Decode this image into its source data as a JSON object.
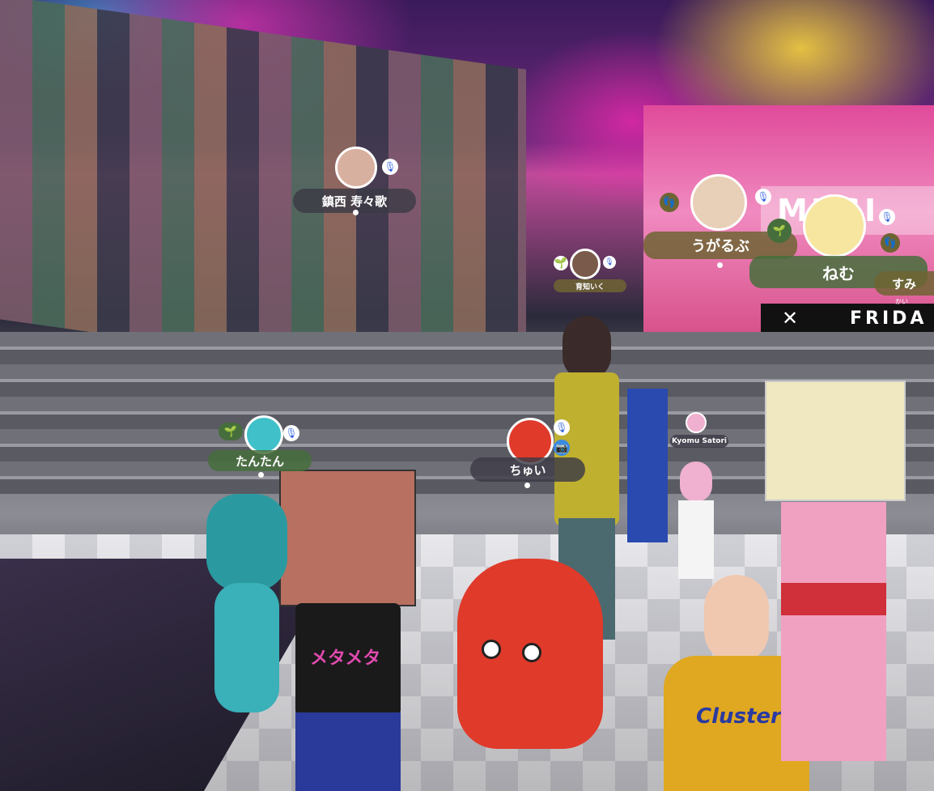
{
  "stage": {
    "screen_right_text": "MUSI",
    "screen_right_bottom_text": "FRIDA"
  },
  "players": [
    {
      "id": "chinzei",
      "name": "鎮西 寿々歌",
      "mic": "muted"
    },
    {
      "id": "ugarubu",
      "name": "うがるぶ",
      "mic": "muted",
      "badge": "footprints-icon"
    },
    {
      "id": "nemu",
      "name": "ねむ",
      "mic": "muted",
      "badge": "sprout-icon"
    },
    {
      "id": "sumi",
      "name": "すみ",
      "badge": "footprints-icon"
    },
    {
      "id": "ikuchi",
      "name": "育知いく"
    },
    {
      "id": "kai",
      "name": "かい"
    },
    {
      "id": "kyomu",
      "name": "Kyomu Satori"
    },
    {
      "id": "tantan",
      "name": "たんたん",
      "mic": "muted",
      "badge": "sprout-icon"
    },
    {
      "id": "chui",
      "name": "ちゅい",
      "mic": "muted",
      "camera": true
    }
  ],
  "shirt_text": "メタメタ",
  "hoodie_text": "Cluster",
  "colors": {
    "pill_dark": "#3c3a46",
    "pill_olive": "#6e6432",
    "pill_green": "#466e3c",
    "mic_blue": "#3a6ae0",
    "badge_green": "#4a8a3a"
  }
}
